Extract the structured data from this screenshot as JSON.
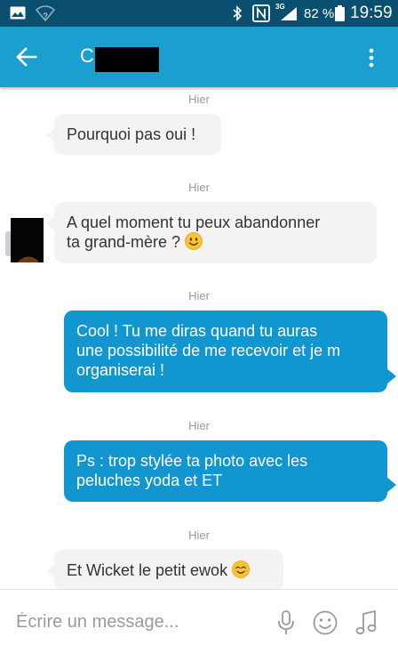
{
  "status_bar": {
    "network_type": "3G",
    "battery_percent": "82 %",
    "time": "19:59",
    "icons": [
      "gallery-icon",
      "wifi-icon",
      "bluetooth-icon",
      "nfc-icon",
      "signal-icon",
      "battery-icon"
    ]
  },
  "header": {
    "contact_initial": "C",
    "back_icon": "arrow-left-icon",
    "menu_icon": "more-vert-icon"
  },
  "messages": [
    {
      "day": "Hier",
      "direction": "incoming",
      "text": "Pourquoi pas oui !"
    },
    {
      "day": "Hier",
      "direction": "incoming",
      "lines": [
        "A quel moment tu peux abandonner",
        "ta grand-mère ?"
      ],
      "emoji": "smiling-face-icon"
    },
    {
      "day": "Hier",
      "direction": "outgoing",
      "lines": [
        "Cool ! Tu me diras quand tu auras",
        "une possibilité de me recevoir et je m",
        "organiserai !"
      ]
    },
    {
      "day": "Hier",
      "direction": "outgoing",
      "lines": [
        "Ps : trop stylée ta photo avec les",
        "peluches yoda et ET"
      ]
    },
    {
      "day": "Hier",
      "direction": "incoming",
      "text": "Et Wicket le petit ewok",
      "emoji": "smiling-eyes-face-icon"
    }
  ],
  "composer": {
    "placeholder": "Écrire un message...",
    "value": ""
  },
  "colors": {
    "status_bar": "#0a4f6f",
    "app_bar": "#1a9fd0",
    "outgoing_bubble": "#1196cf",
    "incoming_bubble": "#f5f2f2"
  }
}
